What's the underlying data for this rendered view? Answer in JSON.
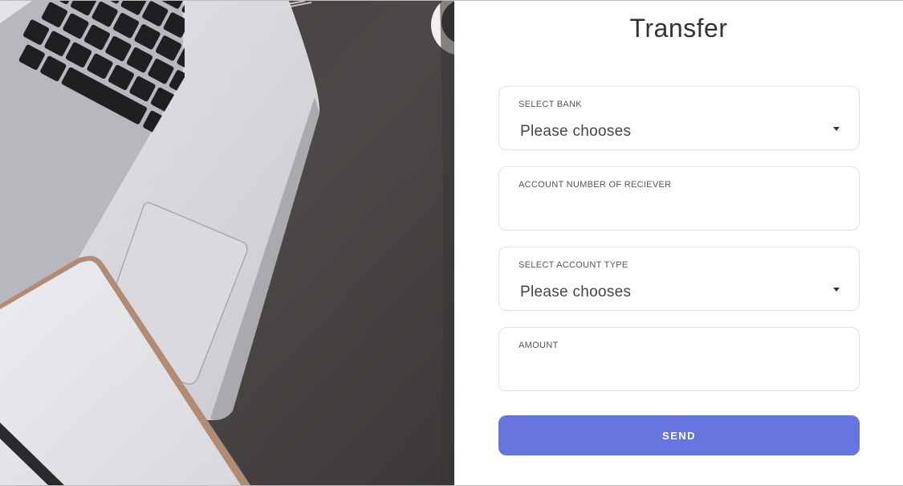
{
  "form": {
    "title": "Transfer",
    "fields": [
      {
        "label": "SELECT BANK",
        "type": "select",
        "value": "Please chooses"
      },
      {
        "label": "ACCOUNT NUMBER OF RECIEVER",
        "type": "text",
        "value": ""
      },
      {
        "label": "SELECT ACCOUNT TYPE",
        "type": "select",
        "value": "Please chooses"
      },
      {
        "label": "AMOUNT",
        "type": "text",
        "value": ""
      }
    ],
    "send_label": "SEND"
  },
  "icons": {
    "dropdown": "caret-down-icon"
  },
  "colors": {
    "accent": "#6675df",
    "desk": "#4a4746",
    "border": "#e2e2e2",
    "title_text": "#333333"
  }
}
